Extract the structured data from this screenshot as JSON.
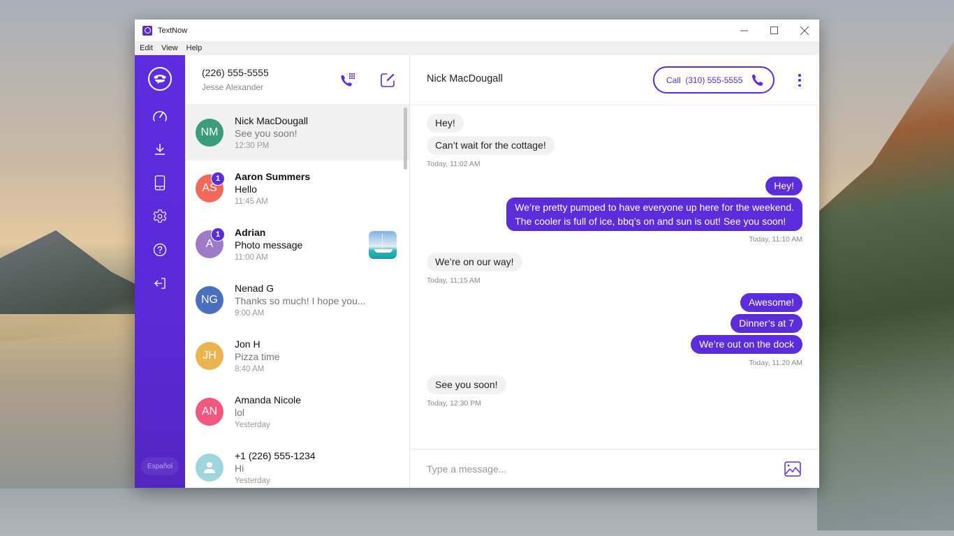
{
  "window": {
    "title": "TextNow",
    "controls": {
      "minimize": "—",
      "maximize": "☐",
      "close": "✕"
    }
  },
  "menubar": {
    "items": [
      {
        "label": "Edit"
      },
      {
        "label": "View"
      },
      {
        "label": "Help"
      }
    ]
  },
  "sidebar": {
    "logo": "textnow-logo-icon",
    "items": [
      {
        "icon": "speedometer-icon"
      },
      {
        "icon": "download-icon"
      },
      {
        "icon": "phone-device-icon"
      },
      {
        "icon": "gear-icon"
      },
      {
        "icon": "help-icon"
      },
      {
        "icon": "logout-icon"
      }
    ],
    "language_button": "Español",
    "accent": "#5b2cd9"
  },
  "account": {
    "number": "(226) 555-5555",
    "name": "Jesse Alexander"
  },
  "conversations": [
    {
      "initials": "NM",
      "name": "Nick MacDougall",
      "preview": "See you soon!",
      "time": "12:30 PM",
      "color": "#3a9c7b",
      "unread": false,
      "badge": null,
      "active": true
    },
    {
      "initials": "AS",
      "name": "Aaron Summers",
      "preview": "Hello",
      "time": "11:45 AM",
      "color": "#f2695a",
      "unread": true,
      "badge": "1",
      "active": false
    },
    {
      "initials": "A",
      "name": "Adrian",
      "preview": "Photo message",
      "time": "11:00 AM",
      "color": "#9c7bc9",
      "unread": true,
      "badge": "1",
      "active": false,
      "thumbnail": "sailboat-photo"
    },
    {
      "initials": "NG",
      "name": "Nenad G",
      "preview": "Thanks so much! I hope you...",
      "time": "9:00 AM",
      "color": "#4a6fbf",
      "unread": false,
      "badge": null,
      "active": false
    },
    {
      "initials": "JH",
      "name": "Jon H",
      "preview": "Pizza time",
      "time": "8:40 AM",
      "color": "#ecb451",
      "unread": false,
      "badge": null,
      "active": false
    },
    {
      "initials": "AN",
      "name": "Amanda Nicole",
      "preview": "lol",
      "time": "Yesterday",
      "color": "#f2587e",
      "unread": false,
      "badge": null,
      "active": false
    },
    {
      "initials": "",
      "name": "+1 (226) 555-1234",
      "preview": "Hi",
      "time": "Yesterday",
      "color": "#9fd6dd",
      "unread": false,
      "badge": null,
      "active": false,
      "avatar_icon": "person-icon"
    }
  ],
  "chat": {
    "contact_name": "Nick MacDougall",
    "call_button": "Call  (310) 555-5555",
    "messages": [
      {
        "dir": "in",
        "text": "Hey!"
      },
      {
        "dir": "in",
        "text": "Can’t wait for the cottage!"
      },
      {
        "dir": "in",
        "timestamp": "Today, 11:02 AM"
      },
      {
        "dir": "out",
        "text": "Hey!"
      },
      {
        "dir": "out",
        "text": "We’re pretty pumped to have everyone up here for the weekend.\nThe cooler is full of ice, bbq’s on and sun is out!  See you soon!"
      },
      {
        "dir": "out",
        "timestamp": "Today, 11:10 AM"
      },
      {
        "dir": "in",
        "text": "We’re on our way!"
      },
      {
        "dir": "in",
        "timestamp": "Today, 11:15 AM"
      },
      {
        "dir": "out",
        "text": "Awesome!"
      },
      {
        "dir": "out",
        "text": "Dinner’s at 7"
      },
      {
        "dir": "out",
        "text": "We’re out on the dock"
      },
      {
        "dir": "out",
        "timestamp": "Today, 11:20 AM"
      },
      {
        "dir": "in",
        "text": "See you soon!"
      },
      {
        "dir": "in",
        "timestamp": "Today, 12:30 PM"
      }
    ],
    "composer": {
      "placeholder": "Type a message...",
      "value": ""
    }
  }
}
